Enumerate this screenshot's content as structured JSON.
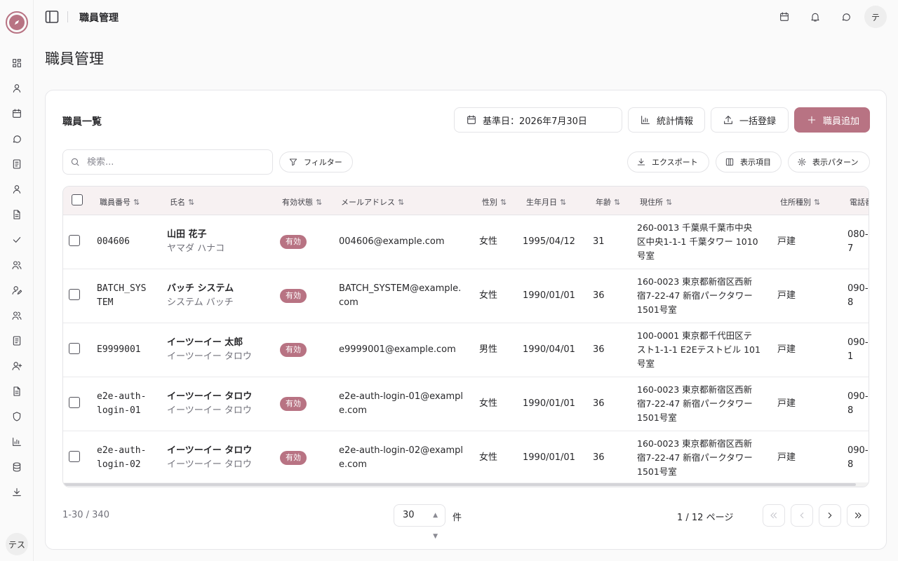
{
  "header": {
    "title": "職員管理",
    "avatar_initial": "テ"
  },
  "sidebar": {
    "avatar_text": "テス",
    "icons": [
      "dashboard-icon",
      "user-icon",
      "calendar-icon",
      "chat-icon",
      "document-icon",
      "user-icon",
      "file-icon",
      "check-icon",
      "users-icon",
      "user-edit-icon",
      "users-icon",
      "document-icon",
      "user-plus-icon",
      "file-icon",
      "shield-icon",
      "bar-chart-icon",
      "database-icon",
      "download-icon"
    ]
  },
  "page": {
    "title": "職員管理"
  },
  "card": {
    "title": "職員一覧",
    "date_button": "基準日：2026年7月30日",
    "stats_button": "統計情報",
    "bulk_button": "一括登録",
    "add_button": "職員追加",
    "search_placeholder": "検索...",
    "filter_button": "フィルター",
    "export_button": "エクスポート",
    "columns_button": "表示項目",
    "pattern_button": "表示パターン"
  },
  "table": {
    "columns": [
      "職員番号",
      "氏名",
      "有効状態",
      "メールアドレス",
      "性別",
      "生年月日",
      "年齢",
      "現住所",
      "住所種別",
      "電話番号"
    ],
    "rows": [
      {
        "id1": "004606",
        "id2": "",
        "name": "山田 花子",
        "kana": "ヤマダ ハナコ",
        "status": "有効",
        "email1": "004606@example.com",
        "email2": "",
        "gender": "女性",
        "birth": "1995/04/12",
        "age": "31",
        "addr1": "260-0013 千葉県千葉市中央",
        "addr2": "区中央1-1-1 千葉タワー 1010",
        "addr3": "号室",
        "addr_type": "戸建",
        "phone1": "080-",
        "phone2": "7"
      },
      {
        "id1": "BATCH_SYS",
        "id2": "TEM",
        "name": "バッチ システム",
        "kana": "システム バッチ",
        "status": "有効",
        "email1": "BATCH_SYSTEM@example.",
        "email2": "com",
        "gender": "女性",
        "birth": "1990/01/01",
        "age": "36",
        "addr1": "160-0023 東京都新宿区西新",
        "addr2": "宿7-22-47 新宿パークタワー",
        "addr3": "1501号室",
        "addr_type": "戸建",
        "phone1": "090-",
        "phone2": "8"
      },
      {
        "id1": "E9999001",
        "id2": "",
        "name": "イーツーイー 太郎",
        "kana": "イーツーイー タロウ",
        "status": "有効",
        "email1": "e9999001@example.com",
        "email2": "",
        "gender": "男性",
        "birth": "1990/04/01",
        "age": "36",
        "addr1": "100-0001 東京都千代田区テ",
        "addr2": "スト1-1-1 E2Eテストビル 101",
        "addr3": "号室",
        "addr_type": "戸建",
        "phone1": "090-",
        "phone2": "1"
      },
      {
        "id1": "e2e-auth-",
        "id2": "login-01",
        "name": "イーツーイー タロウ",
        "kana": "イーツーイー タロウ",
        "status": "有効",
        "email1": "e2e-auth-login-01@exampl",
        "email2": "e.com",
        "gender": "女性",
        "birth": "1990/01/01",
        "age": "36",
        "addr1": "160-0023 東京都新宿区西新",
        "addr2": "宿7-22-47 新宿パークタワー",
        "addr3": "1501号室",
        "addr_type": "戸建",
        "phone1": "090-",
        "phone2": "8"
      },
      {
        "id1": "e2e-auth-",
        "id2": "login-02",
        "name": "イーツーイー タロウ",
        "kana": "イーツーイー タロウ",
        "status": "有効",
        "email1": "e2e-auth-login-02@exampl",
        "email2": "e.com",
        "gender": "女性",
        "birth": "1990/01/01",
        "age": "36",
        "addr1": "160-0023 東京都新宿区西新",
        "addr2": "宿7-22-47 新宿パークタワー",
        "addr3": "1501号室",
        "addr_type": "戸建",
        "phone1": "090-",
        "phone2": "8"
      }
    ]
  },
  "footer": {
    "count": "1-30 / 340",
    "page_size": "30",
    "unit": "件",
    "page_info": "1 / 12 ページ"
  },
  "colors": {
    "accent": "#b87383"
  }
}
